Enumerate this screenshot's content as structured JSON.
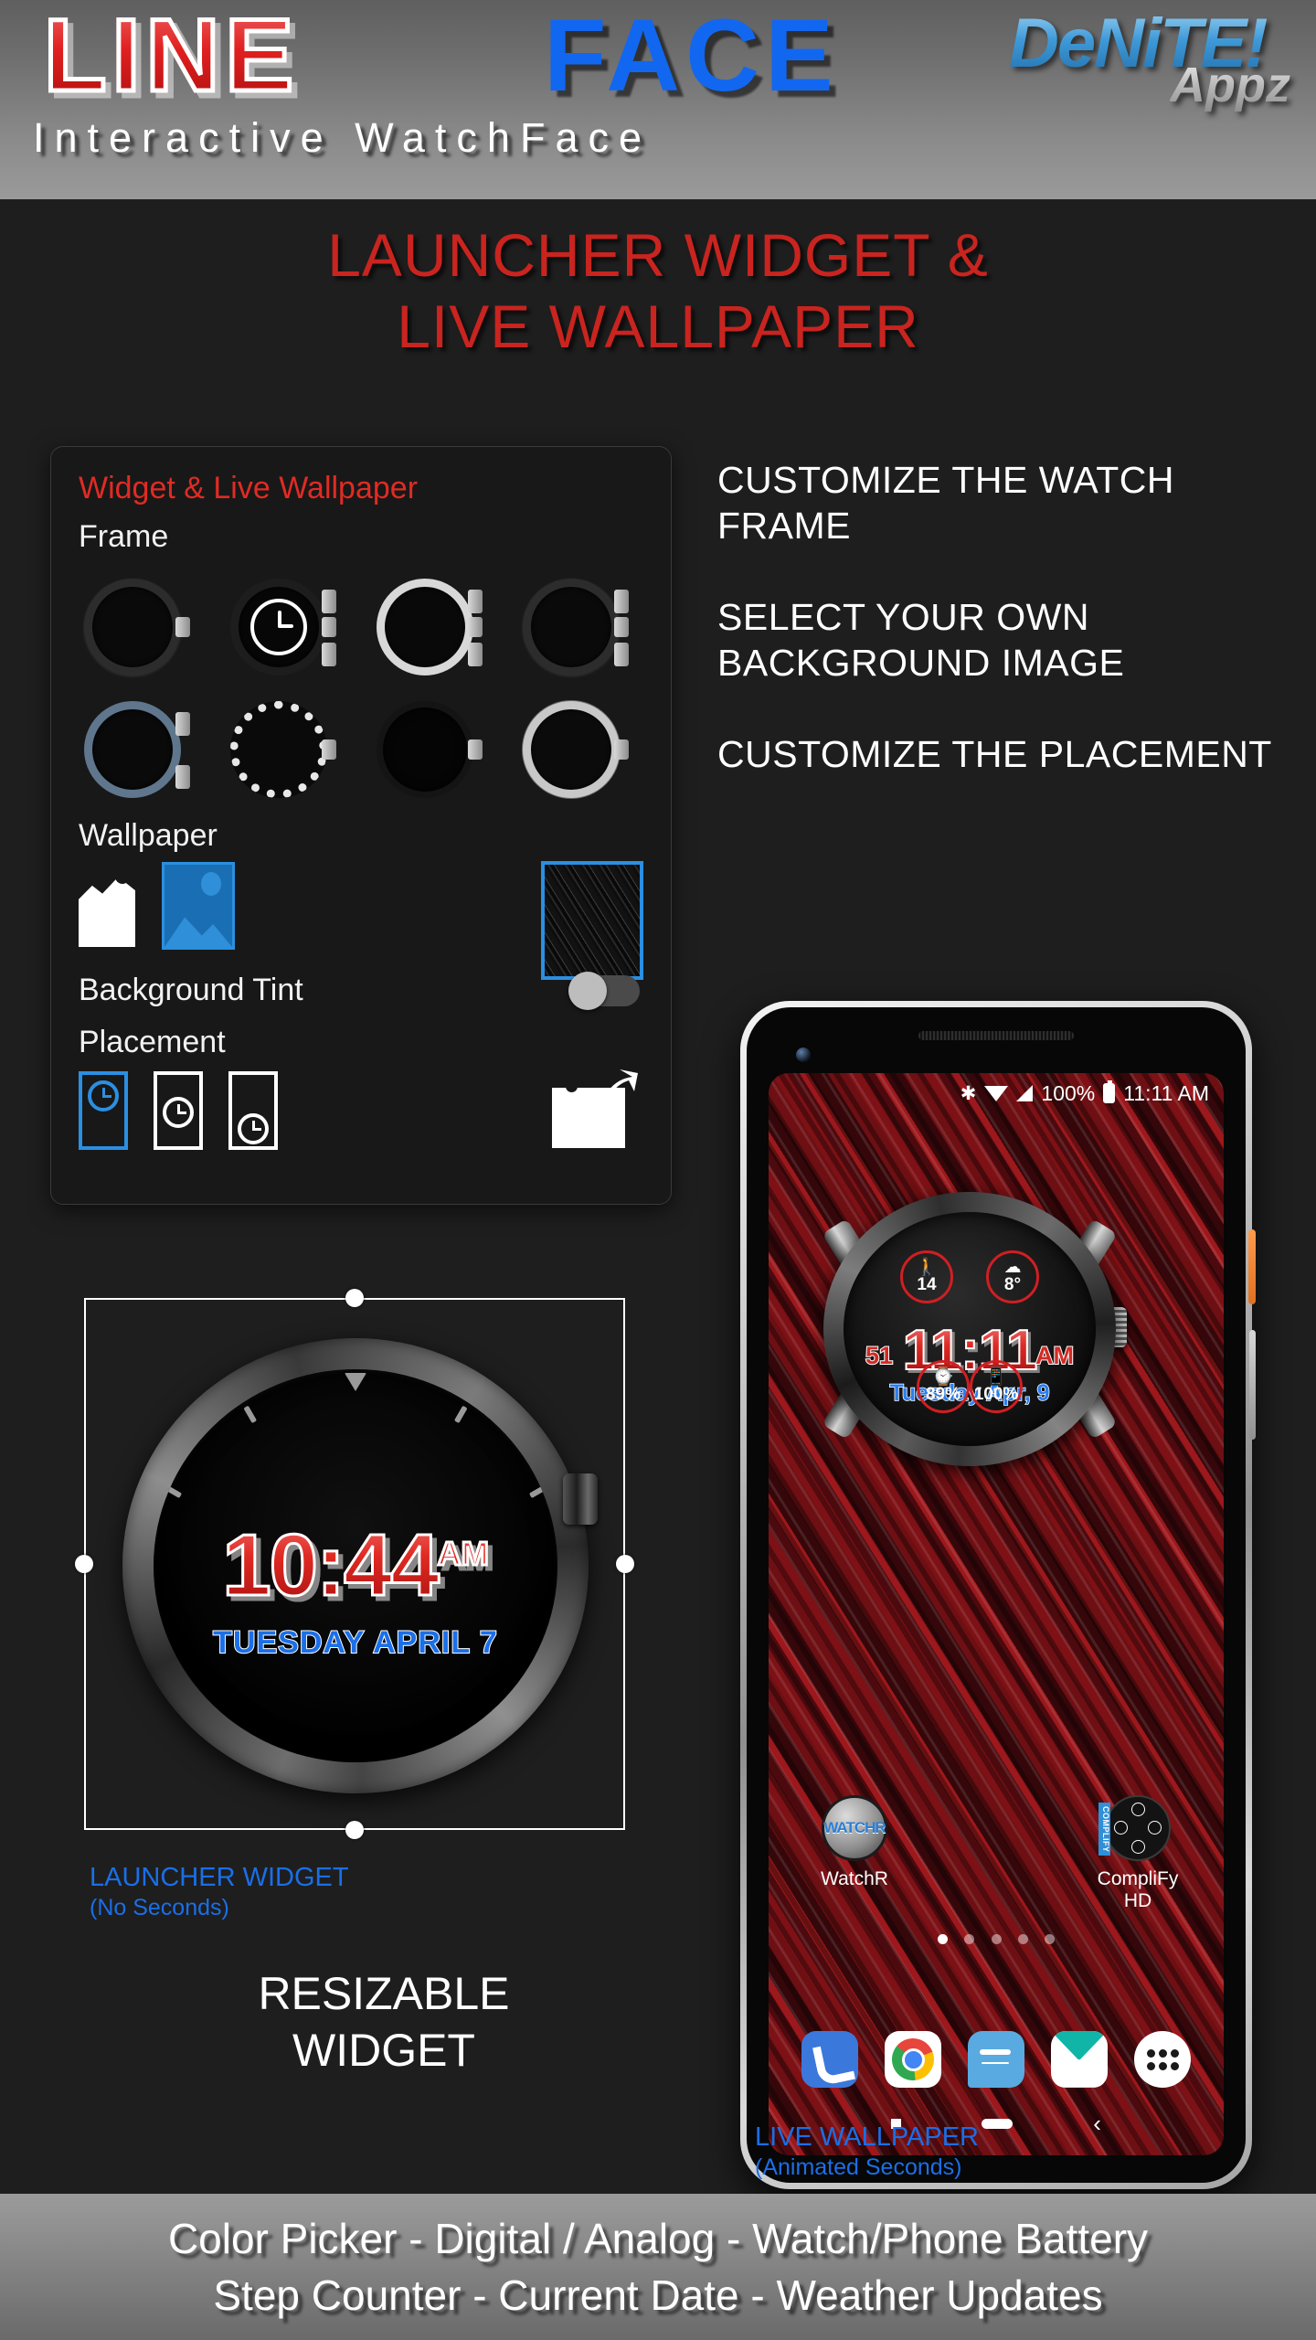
{
  "header": {
    "title_part1": "LINE",
    "title_part2": "FACE",
    "subtitle": "Interactive WatchFace",
    "brand_main": "DeNiTE!",
    "brand_sub": "Appz",
    "colors": {
      "red": "#e02020",
      "blue": "#1267f0",
      "brand_blue": "#3f9ad8"
    }
  },
  "hero": {
    "line1": "LAUNCHER WIDGET &",
    "line2": "LIVE WALLPAPER",
    "color": "#c9241f"
  },
  "settings_panel": {
    "title": "Widget & Live Wallpaper",
    "frame_label": "Frame",
    "frames": [
      {
        "name": "frame-dark-notched",
        "selected": false
      },
      {
        "name": "frame-dark-lugs",
        "selected": true
      },
      {
        "name": "frame-silver-lugs",
        "selected": false
      },
      {
        "name": "frame-black-lugs",
        "selected": false
      },
      {
        "name": "frame-blue-steel",
        "selected": false
      },
      {
        "name": "frame-studded-silver",
        "selected": false
      },
      {
        "name": "frame-plain-black",
        "selected": false
      },
      {
        "name": "frame-knurled-silver",
        "selected": false
      }
    ],
    "wallpaper_label": "Wallpaper",
    "wallpaper_options": [
      {
        "name": "no-image-icon",
        "selected": false
      },
      {
        "name": "pick-image-icon",
        "selected": true
      }
    ],
    "wallpaper_preview": {
      "name": "wallpaper-preview-thumb",
      "selected": true
    },
    "background_tint_label": "Background Tint",
    "background_tint_enabled": false,
    "placement_label": "Placement",
    "placement_options": [
      {
        "name": "placement-top",
        "selected": true
      },
      {
        "name": "placement-middle",
        "selected": false
      },
      {
        "name": "placement-bottom",
        "selected": false
      }
    ],
    "share_image_icon": "share-image-icon"
  },
  "features": [
    "CUSTOMIZE THE WATCH FRAME",
    "SELECT YOUR OWN BACKGROUND IMAGE",
    "CUSTOMIZE THE PLACEMENT"
  ],
  "launcher_widget": {
    "time": "10:44",
    "ampm": "AM",
    "date": "TUESDAY APRIL 7",
    "caption_title": "LAUNCHER WIDGET",
    "caption_sub": "(No Seconds)",
    "resizable_line1": "RESIZABLE",
    "resizable_line2": "WIDGET"
  },
  "phone": {
    "statusbar": {
      "bluetooth": "bluetooth-icon",
      "wifi": "wifi-icon",
      "signal": "signal-icon",
      "battery_percent": "100%",
      "battery": "battery-icon",
      "clock": "11:11 AM"
    },
    "watchface": {
      "steps_icon": "walking-icon",
      "steps_value": "14",
      "weather_icon": "cloud-icon",
      "weather_value": "8°",
      "time": "11:11",
      "seconds": "51",
      "ampm": "AM",
      "date": "Tuesday Apr, 9",
      "watch_battery_icon": "watch-icon",
      "watch_battery_value": "89%",
      "phone_battery_icon": "phone-icon",
      "phone_battery_value": "100%"
    },
    "apps": [
      {
        "label": "WatchR",
        "icon": "watchr-icon"
      },
      {
        "label": "CompliFy HD",
        "icon": "complify-icon"
      }
    ],
    "page_dots": {
      "count": 5,
      "active_index": 0
    },
    "dock": [
      {
        "name": "phone-app-icon"
      },
      {
        "name": "chrome-app-icon"
      },
      {
        "name": "messages-app-icon"
      },
      {
        "name": "email-app-icon"
      },
      {
        "name": "app-drawer-icon"
      }
    ],
    "navbar": [
      {
        "name": "nav-recents-button"
      },
      {
        "name": "nav-home-button"
      },
      {
        "name": "nav-back-button"
      }
    ],
    "caption_title": "LIVE WALLPAPER",
    "caption_sub": "(Animated Seconds)"
  },
  "footer": {
    "line1": "Color Picker - Digital / Analog - Watch/Phone Battery",
    "line2": "Step Counter - Current Date - Weather Updates"
  }
}
